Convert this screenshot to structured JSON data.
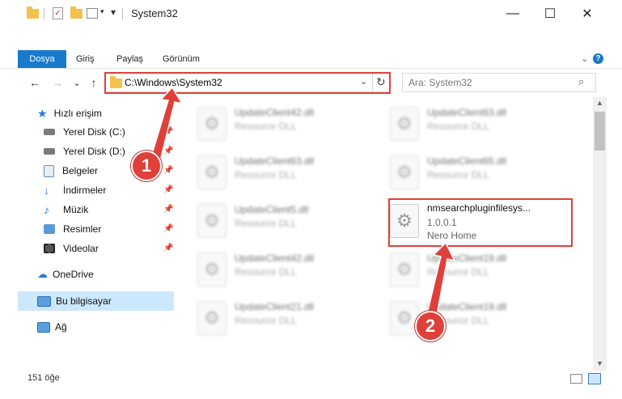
{
  "window": {
    "title": "System32",
    "minimize": "—",
    "maximize": "☐",
    "close": "✕"
  },
  "ribbon": {
    "tabs": [
      "Dosya",
      "Giriş",
      "Paylaş",
      "Görünüm"
    ],
    "help": "?"
  },
  "nav": {
    "back": "←",
    "forward": "→",
    "recent": "⌄",
    "up": "↑",
    "address": "C:\\Windows\\System32",
    "dropdown": "⌄",
    "refresh": "↻",
    "search_placeholder": "Ara: System32"
  },
  "sidebar": {
    "quick_access": "Hızlı erişim",
    "items": [
      {
        "label": "Yerel Disk (C:)"
      },
      {
        "label": "Yerel Disk (D:)"
      },
      {
        "label": "Belgeler"
      },
      {
        "label": "İndirmeler"
      },
      {
        "label": "Müzik"
      },
      {
        "label": "Resimler"
      },
      {
        "label": "Videolar"
      }
    ],
    "onedrive": "OneDrive",
    "this_pc": "Bu bilgisayar",
    "network": "Ağ"
  },
  "files": [
    {
      "name": "UpdateClient42.dll",
      "sub": "Resource DLL"
    },
    {
      "name": "UpdateClient63.dll",
      "sub": "Resource DLL"
    },
    {
      "name": "UpdateClient63.dll",
      "sub": "Resource DLL"
    },
    {
      "name": "UpdateClient65.dll",
      "sub": "Resource DLL"
    },
    {
      "name": "UpdateClient5.dll",
      "sub": "Resource DLL"
    },
    {
      "name": "nmsearchpluginfilesys...",
      "version": "1.0.0.1",
      "company": "Nero Home"
    },
    {
      "name": "UpdateClient42.dll",
      "sub": "Resource DLL"
    },
    {
      "name": "UpdateClient19.dll",
      "sub": "Resource DLL"
    },
    {
      "name": "UpdateClient21.dll",
      "sub": "Resource DLL"
    },
    {
      "name": "UpdateClient19.dll",
      "sub": "Resource DLL"
    }
  ],
  "status": {
    "count": "151 öğe"
  },
  "annotations": {
    "step1": "1",
    "step2": "2",
    "color": "#e0403a"
  }
}
